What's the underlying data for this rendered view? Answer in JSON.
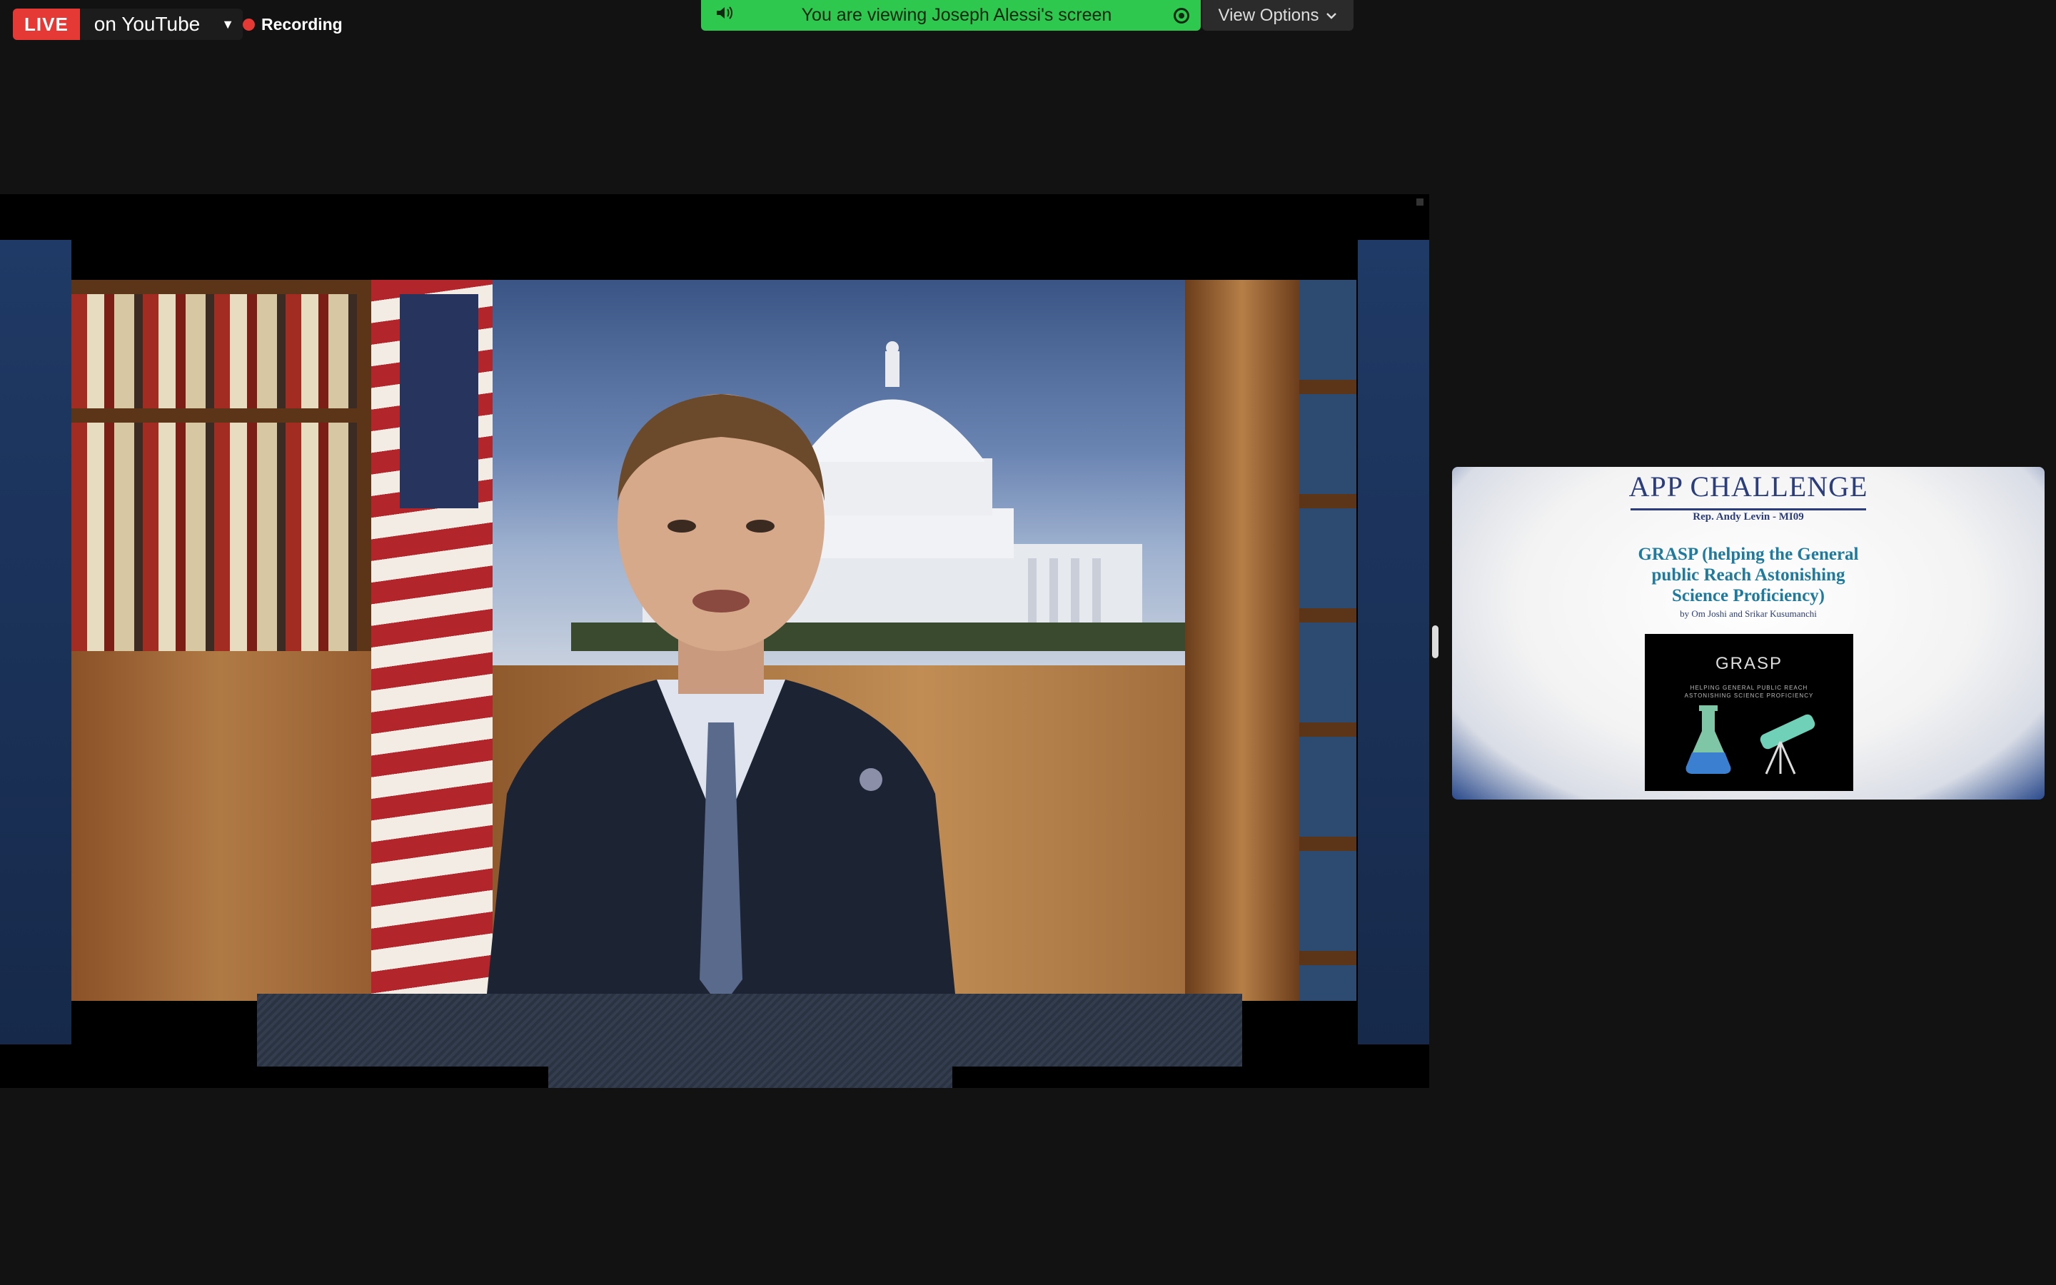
{
  "live": {
    "badge": "LIVE",
    "destination": "on YouTube"
  },
  "recording": {
    "label": "Recording",
    "indicator_color": "#e53935"
  },
  "share_banner": {
    "text": "You are viewing Joseph Alessi's screen",
    "color": "#2ec84f",
    "speaker_icon": "speaker-icon",
    "record_icon": "record-icon"
  },
  "view_options": {
    "label": "View Options",
    "icon": "chevron-down-icon"
  },
  "thumbnail": {
    "logo_text": "APP CHALLENGE",
    "rep_line": "Rep. Andy Levin - MI09",
    "heading_lines": [
      "GRASP (helping the General",
      "public Reach Astonishing",
      "Science Proficiency)"
    ],
    "byline": "by Om Joshi and Srikar Kusumanchi",
    "app_name": "GRASP",
    "app_sub_lines": [
      "HELPING GENERAL PUBLIC REACH",
      "ASTONISHING SCIENCE PROFICIENCY"
    ]
  }
}
